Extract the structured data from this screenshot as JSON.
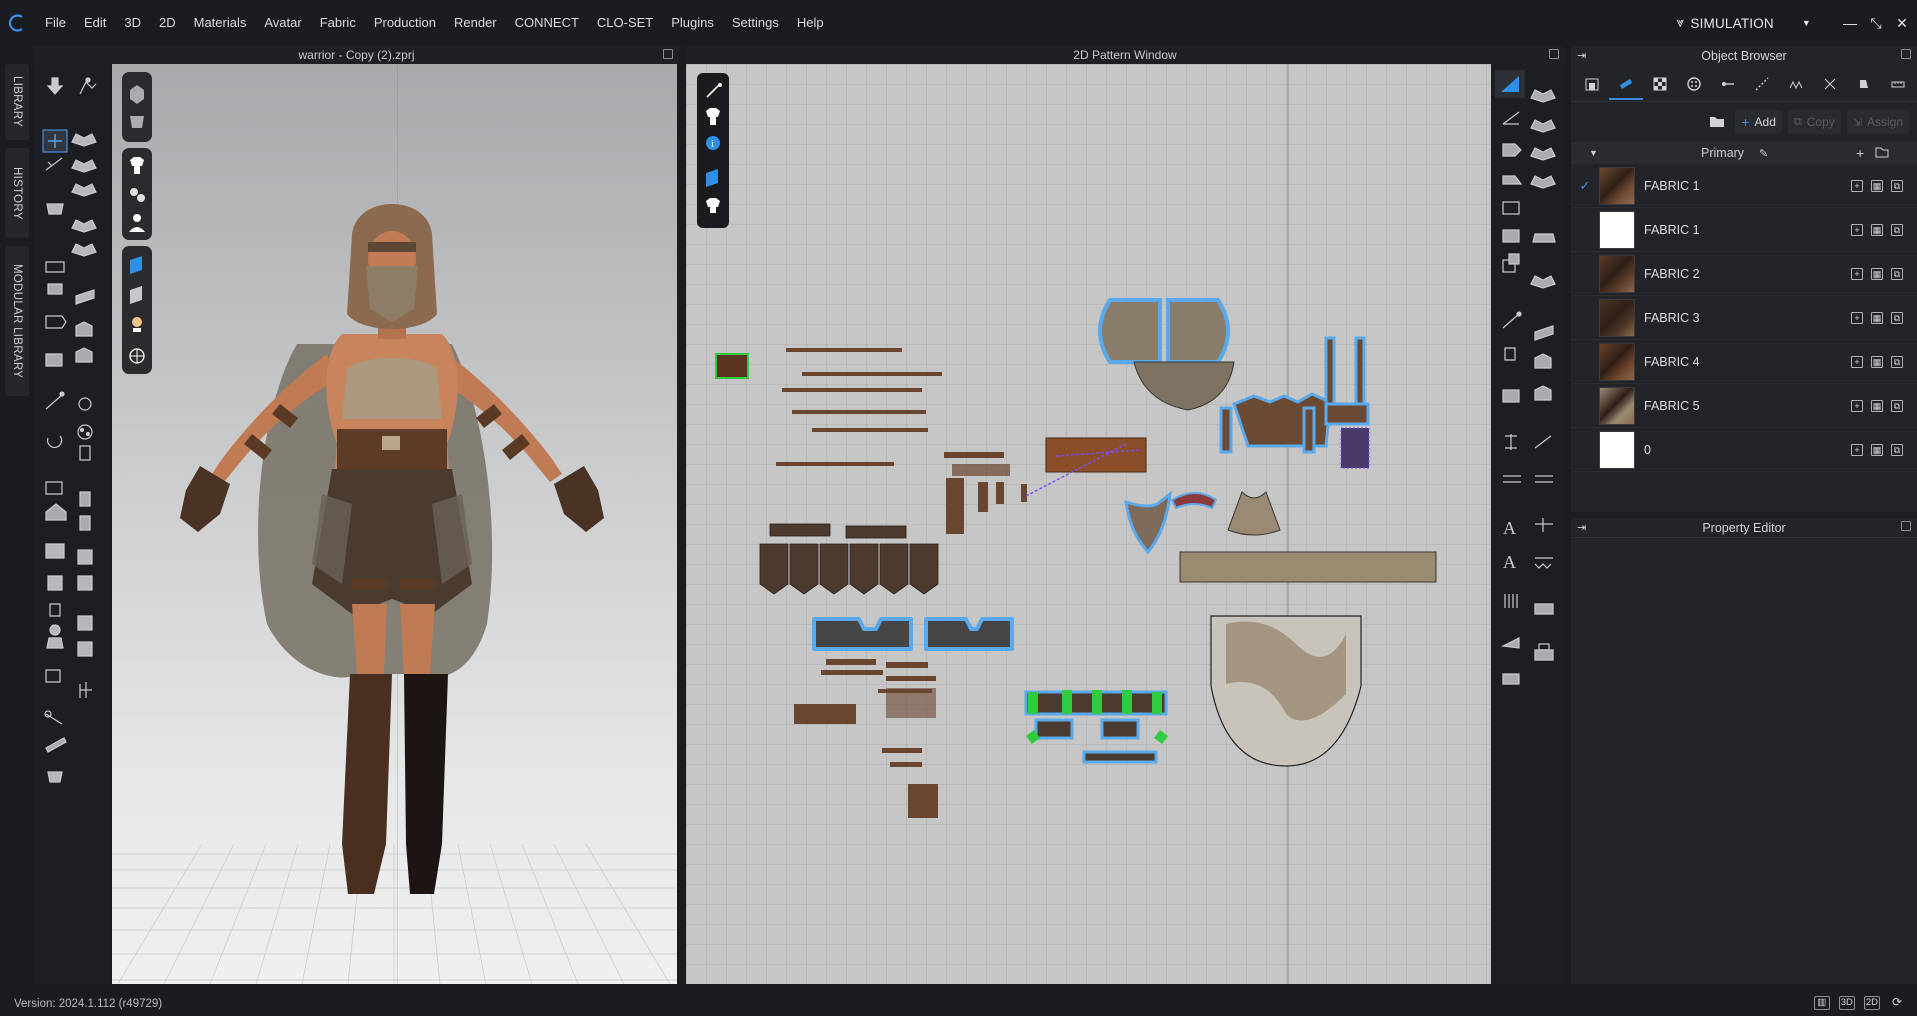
{
  "menu": {
    "items": [
      "File",
      "Edit",
      "3D",
      "2D",
      "Materials",
      "Avatar",
      "Fabric",
      "Production",
      "Render",
      "CONNECT",
      "CLO-SET",
      "Plugins",
      "Settings",
      "Help"
    ],
    "mode": "SIMULATION"
  },
  "side_tabs": [
    "LIBRARY",
    "HISTORY",
    "MODULAR LIBRARY"
  ],
  "window3d": {
    "title": "warrior - Copy (2).zprj"
  },
  "window2d": {
    "title": "2D Pattern Window"
  },
  "object_browser": {
    "title": "Object Browser",
    "actions": {
      "add": "Add",
      "copy": "Copy",
      "assign": "Assign"
    },
    "group": "Primary",
    "fabrics": [
      {
        "name": "FABRIC 1",
        "checked": true,
        "swatch": "#6e4a34"
      },
      {
        "name": "FABRIC 1",
        "checked": false,
        "swatch": "#ffffff"
      },
      {
        "name": "FABRIC 2",
        "checked": false,
        "swatch": "#5a3a26"
      },
      {
        "name": "FABRIC 3",
        "checked": false,
        "swatch": "#4b3424"
      },
      {
        "name": "FABRIC 4",
        "checked": false,
        "swatch": "#6b4128"
      },
      {
        "name": "FABRIC 5",
        "checked": false,
        "swatch": "#9a8a74"
      },
      {
        "name": "0",
        "checked": false,
        "swatch": "#ffffff"
      }
    ]
  },
  "property_editor": {
    "title": "Property Editor"
  },
  "status": {
    "version": "Version: 2024.1.112 (r49729)",
    "views": [
      "",
      "3D",
      "2D",
      ""
    ]
  },
  "colors": {
    "accent": "#3a88e0",
    "selection_outline": "#5aa9ec",
    "green_pins": "#2ecc40"
  }
}
